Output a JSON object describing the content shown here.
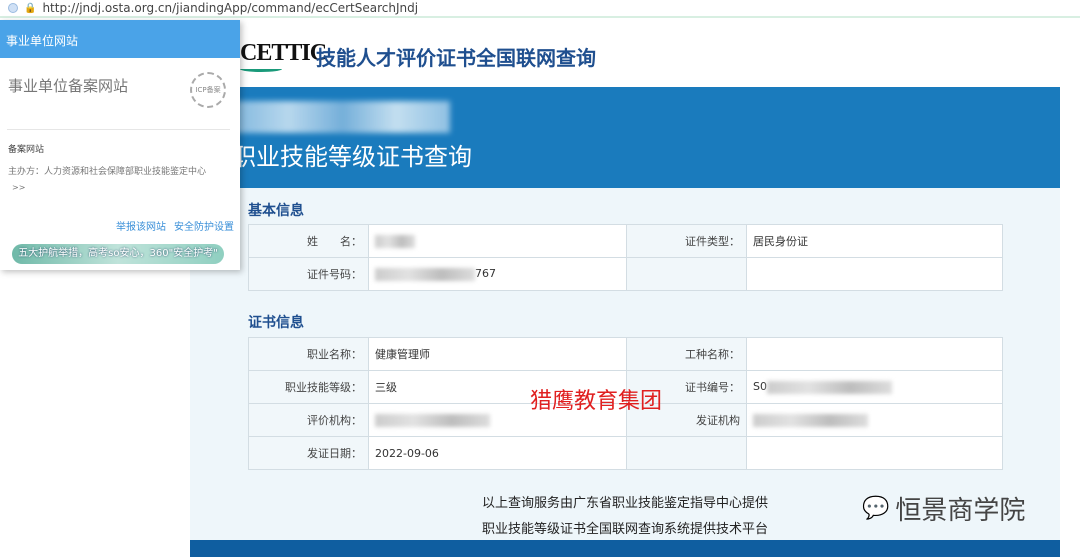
{
  "browser": {
    "url": "http://jndj.osta.org.cn/jiandingApp/command/ecCertSearchJndj"
  },
  "site": {
    "logo": "CETTIC",
    "title": "技能人才评价证书全国联网查询",
    "banner": "职业技能等级证书查询"
  },
  "basic": {
    "heading": "基本信息",
    "rows": [
      {
        "l1": "姓　　名：",
        "v1": "",
        "l2": "证件类型：",
        "v2": "居民身份证"
      },
      {
        "l1": "证件号码：",
        "v1": "767",
        "l2": "",
        "v2": ""
      }
    ]
  },
  "cert": {
    "heading": "证书信息",
    "rows": [
      {
        "l1": "职业名称：",
        "v1": "健康管理师",
        "l2": "工种名称：",
        "v2": ""
      },
      {
        "l1": "职业技能等级：",
        "v1": "三级",
        "l2": "证书编号：",
        "v2": "S0"
      },
      {
        "l1": "评价机构：",
        "v1": "",
        "l2": "发证机构",
        "v2": ""
      },
      {
        "l1": "发证日期：",
        "v1": "2022-09-06",
        "l2": "",
        "v2": ""
      }
    ]
  },
  "watermark": "猎鹰教育集团",
  "footer": {
    "line1": "以上查询服务由广东省职业技能鉴定指导中心提供",
    "line2": "职业技能等级证书全国联网查询系统提供技术平台"
  },
  "wechat": {
    "account": "恒景商学院"
  },
  "popup": {
    "header": "事业单位网站",
    "title": "事业单位备案网站",
    "seal": "ICP备案",
    "section": "备案网站",
    "sponsor": "主办方：人力资源和社会保障部职业技能鉴定中心",
    "more": ">>",
    "report": "举报该网站",
    "settings": "安全防护设置",
    "promo": "五大护航举措，高考so安心，360\"安全护考\""
  }
}
